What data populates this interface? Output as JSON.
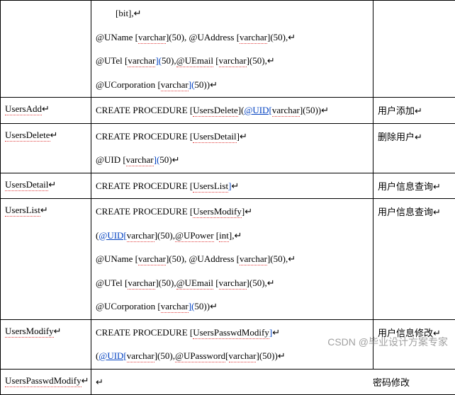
{
  "watermark": "CSDN @毕业设计方案专家",
  "rows": [
    {
      "name": "",
      "desc": "",
      "code": [
        {
          "indent": true,
          "parts": [
            {
              "t": "[bit],",
              "c": ""
            },
            {
              "t": "↵",
              "c": "ret"
            }
          ]
        },
        {
          "parts": [
            {
              "t": "@UName ",
              "c": ""
            },
            {
              "t": "[",
              "c": ""
            },
            {
              "t": "varchar",
              "c": "redsq"
            },
            {
              "t": "](50), ",
              "c": ""
            },
            {
              "t": "@UAddress ",
              "c": ""
            },
            {
              "t": "[",
              "c": ""
            },
            {
              "t": "varchar",
              "c": "redsq"
            },
            {
              "t": "](50),",
              "c": ""
            },
            {
              "t": "↵",
              "c": "ret"
            }
          ]
        },
        {
          "parts": [
            {
              "t": "@UTel ",
              "c": ""
            },
            {
              "t": "[",
              "c": ""
            },
            {
              "t": "varchar",
              "c": "redsq"
            },
            {
              "t": "](",
              "c": "bluesq"
            },
            {
              "t": "50),",
              "c": ""
            },
            {
              "t": "@UEmail",
              "c": "redsq"
            },
            {
              "t": " [",
              "c": ""
            },
            {
              "t": "varchar",
              "c": "redsq"
            },
            {
              "t": "](50),",
              "c": ""
            },
            {
              "t": "↵",
              "c": "ret"
            }
          ]
        },
        {
          "parts": [
            {
              "t": "@UCorporation ",
              "c": ""
            },
            {
              "t": "[",
              "c": ""
            },
            {
              "t": "varchar",
              "c": "redsq"
            },
            {
              "t": "](",
              "c": "bluesq"
            },
            {
              "t": "50))",
              "c": ""
            },
            {
              "t": "↵",
              "c": "ret"
            }
          ]
        }
      ]
    },
    {
      "name": "UsersAdd",
      "desc": "用户添加",
      "code": [
        {
          "parts": [
            {
              "t": "CREATE PROCEDURE [",
              "c": ""
            },
            {
              "t": "UsersDelete",
              "c": "redsq"
            },
            {
              "t": "](",
              "c": ""
            },
            {
              "t": "@UID[",
              "c": "bluesq"
            },
            {
              "t": "varchar",
              "c": "redsq"
            },
            {
              "t": "](50))",
              "c": ""
            },
            {
              "t": "↵",
              "c": "ret"
            }
          ]
        }
      ]
    },
    {
      "name": "UsersDelete",
      "desc": "删除用户",
      "code": [
        {
          "parts": [
            {
              "t": "CREATE PROCEDURE [",
              "c": ""
            },
            {
              "t": "UsersDetail",
              "c": "redsq"
            },
            {
              "t": "]",
              "c": ""
            },
            {
              "t": "↵",
              "c": "ret"
            }
          ]
        },
        {
          "parts": [
            {
              "t": "@UID [",
              "c": ""
            },
            {
              "t": "varchar",
              "c": "redsq"
            },
            {
              "t": "](",
              "c": "bluesq"
            },
            {
              "t": "50)",
              "c": ""
            },
            {
              "t": "↵",
              "c": "ret"
            }
          ]
        }
      ]
    },
    {
      "name": "UsersDetail",
      "desc": "用户信息查询",
      "code": [
        {
          "parts": [
            {
              "t": "CREATE PROCEDURE [",
              "c": ""
            },
            {
              "t": "UsersList",
              "c": "redsq"
            },
            {
              "t": "]",
              "c": "bluesq"
            },
            {
              "t": "↵",
              "c": "ret"
            }
          ]
        }
      ]
    },
    {
      "name": "UsersList",
      "desc": "用户信息查询",
      "code": [
        {
          "parts": [
            {
              "t": "CREATE PROCEDURE [",
              "c": ""
            },
            {
              "t": "UsersModify",
              "c": "redsq"
            },
            {
              "t": "]",
              "c": ""
            },
            {
              "t": "↵",
              "c": "ret"
            }
          ]
        },
        {
          "parts": [
            {
              "t": "(",
              "c": ""
            },
            {
              "t": "@UID[",
              "c": "bluesq"
            },
            {
              "t": "varchar",
              "c": "redsq"
            },
            {
              "t": "](50),",
              "c": ""
            },
            {
              "t": "@UPower",
              "c": "redsq"
            },
            {
              "t": "  [",
              "c": ""
            },
            {
              "t": "int",
              "c": "redsq"
            },
            {
              "t": "],",
              "c": ""
            },
            {
              "t": "↵",
              "c": "ret"
            }
          ]
        },
        {
          "parts": [
            {
              "t": "@UName [",
              "c": ""
            },
            {
              "t": "varchar",
              "c": "redsq"
            },
            {
              "t": "](50), ",
              "c": ""
            },
            {
              "t": "@UAddress  [",
              "c": ""
            },
            {
              "t": "varchar",
              "c": "redsq"
            },
            {
              "t": "](50),",
              "c": ""
            },
            {
              "t": "↵",
              "c": "ret"
            }
          ]
        },
        {
          "parts": [
            {
              "t": "@UTel [",
              "c": ""
            },
            {
              "t": "varchar",
              "c": "redsq"
            },
            {
              "t": "](50),",
              "c": ""
            },
            {
              "t": "@UEmail",
              "c": "redsq"
            },
            {
              "t": " [",
              "c": ""
            },
            {
              "t": "varchar",
              "c": "redsq"
            },
            {
              "t": "](50),",
              "c": ""
            },
            {
              "t": "↵",
              "c": "ret"
            }
          ]
        },
        {
          "parts": [
            {
              "t": "@UCorporation [",
              "c": ""
            },
            {
              "t": "varchar",
              "c": "redsq"
            },
            {
              "t": "](",
              "c": "bluesq"
            },
            {
              "t": "50))",
              "c": ""
            },
            {
              "t": "↵",
              "c": "ret"
            }
          ]
        }
      ]
    },
    {
      "name": "UsersModify",
      "desc": "用户信息修改",
      "code": [
        {
          "parts": [
            {
              "t": "CREATE PROCEDURE [",
              "c": ""
            },
            {
              "t": "UsersPasswdModify",
              "c": "redsq"
            },
            {
              "t": "]",
              "c": "bluesq"
            },
            {
              "t": "↵",
              "c": "ret"
            }
          ]
        },
        {
          "parts": [
            {
              "t": "(",
              "c": ""
            },
            {
              "t": "@UID[",
              "c": "bluesq"
            },
            {
              "t": "varchar",
              "c": "redsq"
            },
            {
              "t": "](50),",
              "c": ""
            },
            {
              "t": "@UPassword",
              "c": "redsq"
            },
            {
              "t": "[",
              "c": ""
            },
            {
              "t": "varchar",
              "c": "redsq"
            },
            {
              "t": "](50))",
              "c": ""
            },
            {
              "t": "↵",
              "c": "ret"
            }
          ]
        }
      ]
    },
    {
      "name": "UsersPasswdModify",
      "desc": "密码修改",
      "fused": true,
      "code": [
        {
          "parts": [
            {
              "t": "↵",
              "c": "ret"
            }
          ]
        }
      ]
    }
  ]
}
